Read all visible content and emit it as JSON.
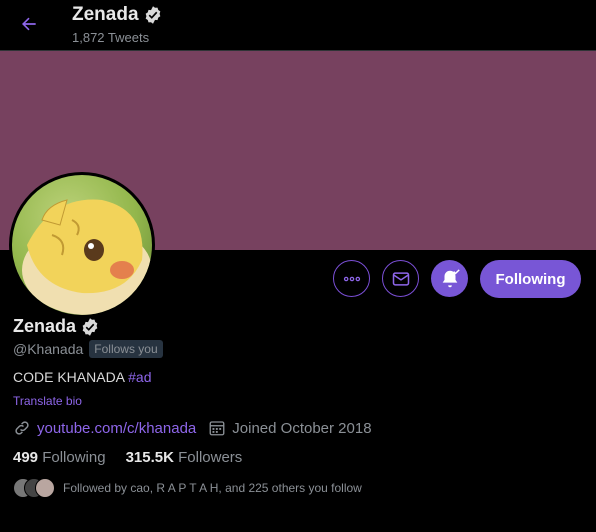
{
  "header": {
    "name": "Zenada",
    "tweet_count": "1,872 Tweets"
  },
  "profile": {
    "name": "Zenada",
    "handle": "@Khanada",
    "follows_you": "Follows you",
    "bio_text": "CODE KHANADA",
    "bio_hashtag": "#ad",
    "translate": "Translate bio",
    "website": "youtube.com/c/khanada",
    "joined": "Joined October 2018",
    "following_count": "499",
    "following_label": "Following",
    "followers_count": "315.5K",
    "followers_label": "Followers",
    "followed_by": "Followed by cao, R A P T A H, and 225 others you follow"
  },
  "buttons": {
    "following": "Following"
  },
  "colors": {
    "accent": "#7856d6",
    "banner": "#77415f",
    "background": "#000000"
  },
  "icons": [
    "back-arrow-icon",
    "verified-badge-icon",
    "more-icon",
    "mail-icon",
    "bell-icon",
    "link-icon",
    "calendar-icon"
  ]
}
